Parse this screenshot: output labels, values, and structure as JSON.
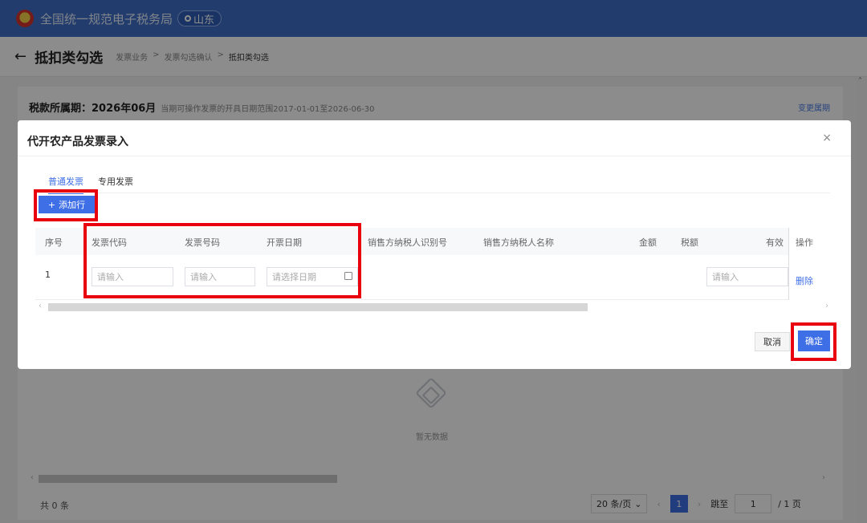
{
  "topbar": {
    "brand": "全国统一规范电子税务局",
    "region": "山东"
  },
  "header": {
    "back": "←",
    "title": "抵扣类勾选",
    "breadcrumb": [
      "发票业务",
      ">",
      "发票勾选确认",
      ">",
      "抵扣类勾选"
    ]
  },
  "period": {
    "label": "税款所属期：",
    "value": "2026年06月",
    "hint": "当期可操作发票的开具日期范围2017-01-01至2026-06-30",
    "link": "变更属期"
  },
  "background": {
    "empty_text": "暂无数据",
    "total": "共 0 条",
    "page_size": "20 条/页",
    "page": "1",
    "jump_label": "跳至",
    "jump_value": "1",
    "page_total": "/ 1 页"
  },
  "dialog": {
    "title": "代开农产品发票录入",
    "close": "×",
    "tabs": [
      "普通发票",
      "专用发票"
    ],
    "add_row": "添加行",
    "columns": [
      "序号",
      "发票代码",
      "发票号码",
      "开票日期",
      "销售方纳税人识别号",
      "销售方纳税人名称",
      "金额",
      "税额",
      "有效",
      "操作"
    ],
    "row": {
      "index": "1",
      "code_placeholder": "请输入",
      "number_placeholder": "请输入",
      "date_placeholder": "请选择日期",
      "valid_placeholder": "请输入",
      "delete": "删除"
    },
    "cancel": "取消",
    "confirm": "确定"
  },
  "colors": {
    "primary": "#3f6fe6",
    "topbar": "#3f6fc7",
    "highlight": "#e8000e"
  }
}
